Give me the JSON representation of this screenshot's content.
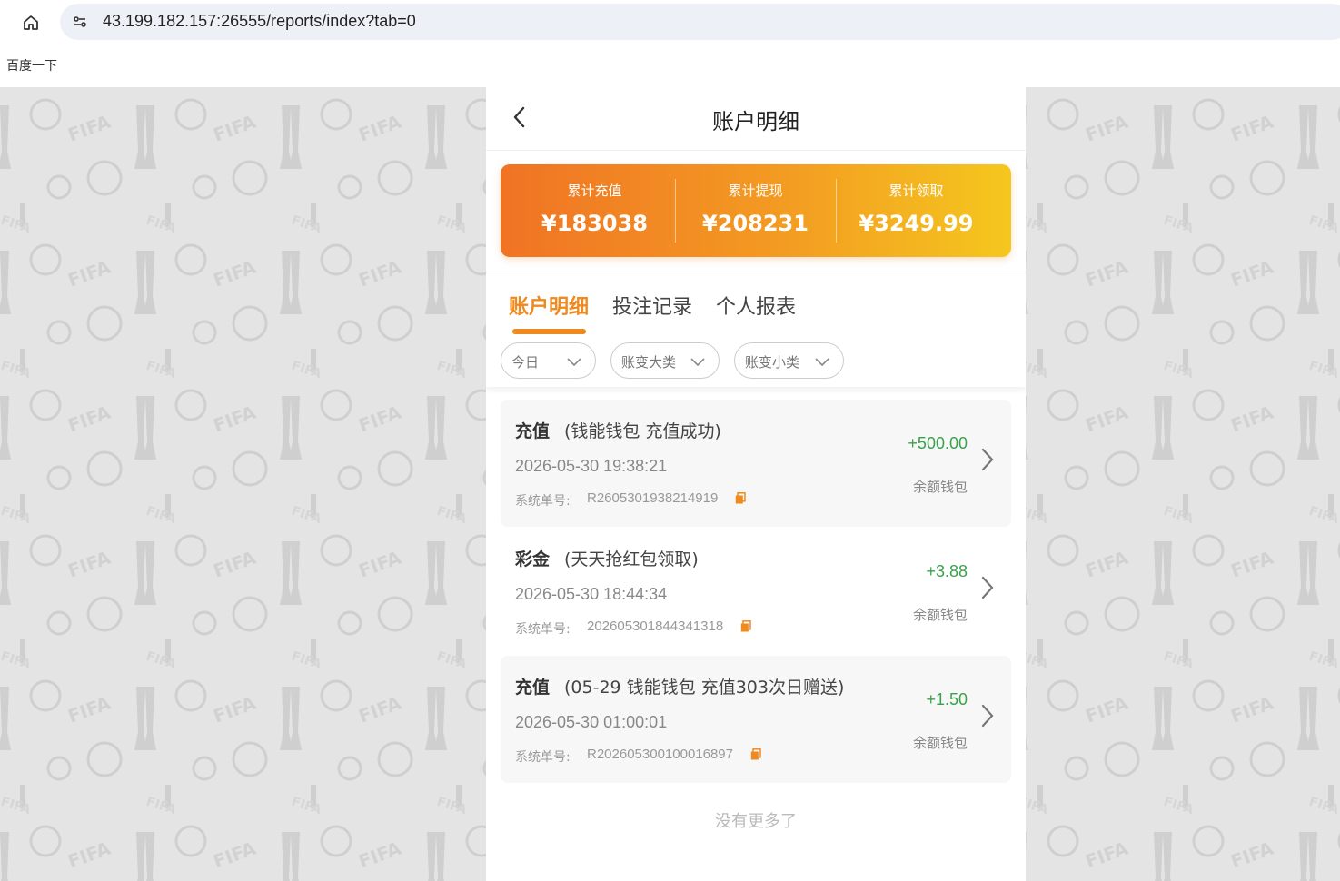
{
  "browser": {
    "url": "43.199.182.157:26555/reports/index?tab=0",
    "bookmark": "百度一下"
  },
  "header": {
    "title": "账户明细"
  },
  "summary": [
    {
      "label": "累计充值",
      "value": "¥183038"
    },
    {
      "label": "累计提现",
      "value": "¥208231"
    },
    {
      "label": "累计领取",
      "value": "¥3249.99"
    }
  ],
  "tabs": [
    {
      "label": "账户明细",
      "active": true
    },
    {
      "label": "投注记录",
      "active": false
    },
    {
      "label": "个人报表",
      "active": false
    }
  ],
  "filters": [
    {
      "label": "今日"
    },
    {
      "label": "账变大类"
    },
    {
      "label": "账变小类"
    }
  ],
  "records": [
    {
      "type": "充值",
      "desc": "(钱能钱包 充值成功)",
      "time": "2026-05-30 19:38:21",
      "order_label": "系统单号:",
      "order": "R2605301938214919",
      "amount": "+500.00",
      "wallet": "余额钱包"
    },
    {
      "type": "彩金",
      "desc": "(天天抢红包领取)",
      "time": "2026-05-30 18:44:34",
      "order_label": "系统单号:",
      "order": "202605301844341318",
      "amount": "+3.88",
      "wallet": "余额钱包"
    },
    {
      "type": "充值",
      "desc": "(05-29 钱能钱包 充值303次日赠送)",
      "time": "2026-05-30 01:00:01",
      "order_label": "系统单号:",
      "order": "R202605300100016897",
      "amount": "+1.50",
      "wallet": "余额钱包"
    }
  ],
  "footer": {
    "no_more": "没有更多了"
  },
  "colors": {
    "accent": "#f08a1e",
    "positive": "#3aa14a",
    "gradient_start": "#f07324",
    "gradient_end": "#f5c71e"
  }
}
